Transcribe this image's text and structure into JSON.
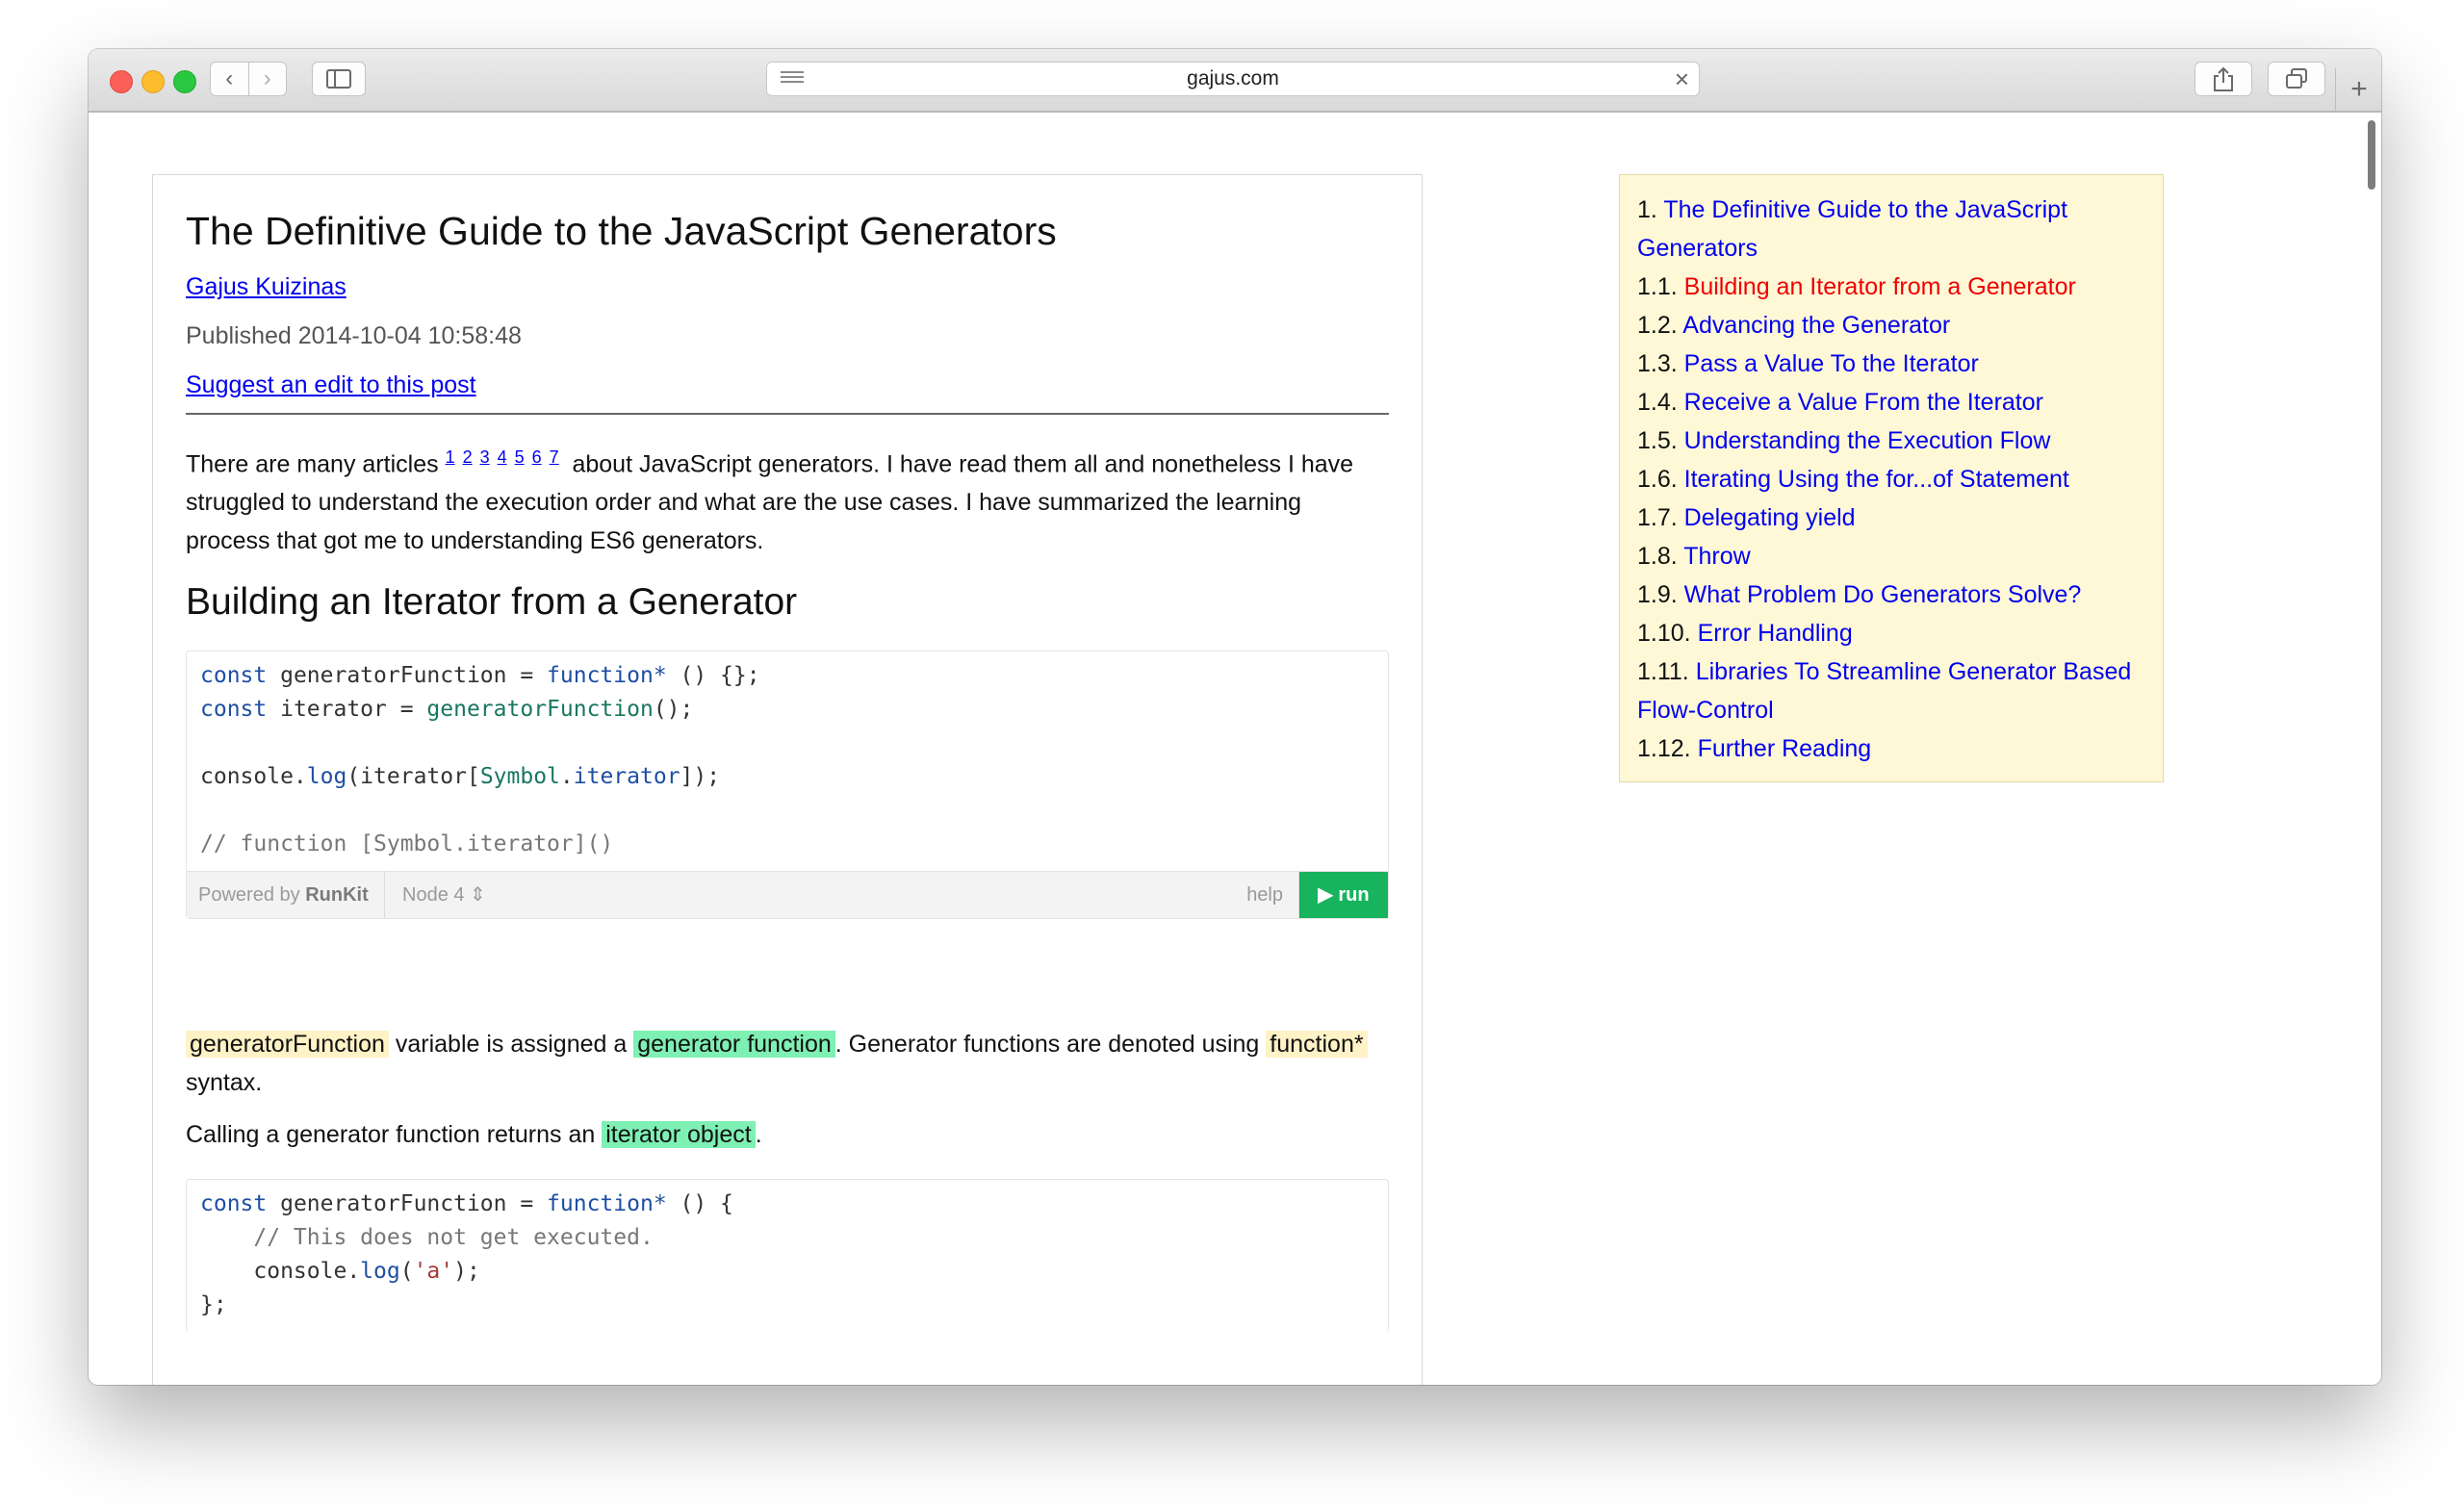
{
  "browser": {
    "url": "gajus.com",
    "back_glyph": "‹",
    "forward_glyph": "›",
    "close_glyph": "×",
    "newtab_glyph": "+",
    "icons": [
      "back-icon",
      "forward-icon",
      "sidebar-icon",
      "reader-icon",
      "close-icon",
      "share-icon",
      "tabs-icon",
      "plus-icon"
    ]
  },
  "article": {
    "title": "The Definitive Guide to the JavaScript Generators",
    "author": "Gajus Kuizinas",
    "published": "Published 2014-10-04 10:58:48",
    "suggest_edit": "Suggest an edit to this post",
    "intro_before": "There are many articles",
    "intro_refs": [
      "1",
      "2",
      "3",
      "4",
      "5",
      "6",
      "7"
    ],
    "intro_after": "about JavaScript generators. I have read them all and nonetheless I have struggled to understand the execution order and what are the use cases. I have summarized the learning process that got me to understanding ES6 generators.",
    "section_heading": "Building an Iterator from a Generator",
    "para1": {
      "code1": "generatorFunction",
      "text1": "variable is assigned a",
      "link1": "generator function",
      "text2": ". Generator functions are denoted using",
      "code2": "function*",
      "text3": "syntax."
    },
    "para2": {
      "text1": "Calling a generator function returns an",
      "link1": "iterator object",
      "text2": "."
    }
  },
  "code_block1": {
    "l1": {
      "kw1": "const",
      "t1": " generatorFunction = ",
      "kw2": "function*",
      "t2": " () {};"
    },
    "l2": {
      "kw1": "const",
      "t1": " iterator = ",
      "fn": "generatorFunction",
      "t2": "();"
    },
    "l3": {
      "t1": "console.",
      "fn1": "log",
      "t2": "(iterator[",
      "fn2": "Symbol",
      "t3": ".",
      "fn3": "iterator",
      "t4": "]);"
    },
    "l4": {
      "cm": "// function [Symbol.iterator]()"
    }
  },
  "runkit": {
    "powered_prefix": "Powered by",
    "brand": "RunKit",
    "node": "Node 4 ⇕",
    "help": "help",
    "run": "▶ run"
  },
  "code_block2": {
    "l1": {
      "kw1": "const",
      "t1": " generatorFunction = ",
      "kw2": "function*",
      "t2": " () {"
    },
    "l2": {
      "cm": "    // This does not get executed."
    },
    "l3": {
      "t1": "    console.",
      "fn": "log",
      "t2": "(",
      "str": "'a'",
      "t3": ");"
    },
    "l4": {
      "t1": "};"
    }
  },
  "toc": [
    {
      "num": "1.",
      "label": "The Definitive Guide to the JavaScript Generators",
      "active": false
    },
    {
      "num": "1.1.",
      "label": "Building an Iterator from a Generator",
      "active": true
    },
    {
      "num": "1.2.",
      "label": "Advancing the Generator",
      "active": false
    },
    {
      "num": "1.3.",
      "label": "Pass a Value To the Iterator",
      "active": false
    },
    {
      "num": "1.4.",
      "label": "Receive a Value From the Iterator",
      "active": false
    },
    {
      "num": "1.5.",
      "label": "Understanding the Execution Flow",
      "active": false
    },
    {
      "num": "1.6.",
      "label": "Iterating Using the for...of Statement",
      "active": false
    },
    {
      "num": "1.7.",
      "label": "Delegating yield",
      "active": false
    },
    {
      "num": "1.8.",
      "label": "Throw",
      "active": false
    },
    {
      "num": "1.9.",
      "label": "What Problem Do Generators Solve?",
      "active": false
    },
    {
      "num": "1.10.",
      "label": "Error Handling",
      "active": false
    },
    {
      "num": "1.11.",
      "label": "Libraries To Streamline Generator Based Flow-Control",
      "active": false
    },
    {
      "num": "1.12.",
      "label": "Further Reading",
      "active": false
    }
  ],
  "colors": {
    "link": "#0000ee",
    "active_link": "#ee0000",
    "toc_bg": "#fff8d7",
    "highlight_code": "#fff2c6",
    "highlight_term": "#7ef0b3",
    "run_button": "#18b35d"
  }
}
